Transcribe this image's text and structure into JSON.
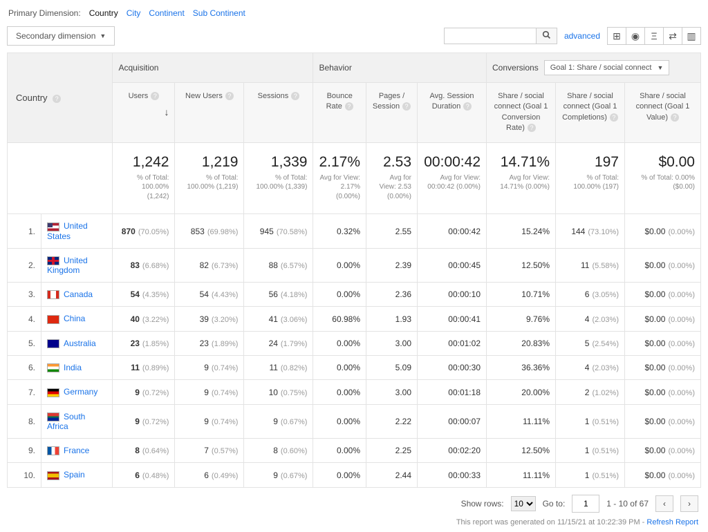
{
  "primaryDimension": {
    "label": "Primary Dimension:",
    "active": "Country",
    "links": [
      "City",
      "Continent",
      "Sub Continent"
    ]
  },
  "secondaryDimension": {
    "label": "Secondary dimension"
  },
  "advancedLink": "advanced",
  "table": {
    "countryHeader": "Country",
    "groups": {
      "acquisition": "Acquisition",
      "behavior": "Behavior",
      "conversions": "Conversions"
    },
    "goalSelector": "Goal 1: Share / social connect",
    "metrics": {
      "users": "Users",
      "newUsers": "New Users",
      "sessions": "Sessions",
      "bounce": "Bounce Rate",
      "pages": "Pages / Session",
      "avgDur": "Avg. Session Duration",
      "convRate": "Share / social connect (Goal 1 Conversion Rate)",
      "compl": "Share / social connect (Goal 1 Completions)",
      "value": "Share / social connect (Goal 1 Value)"
    },
    "totals": {
      "users": {
        "v": "1,242",
        "sub": "% of Total: 100.00% (1,242)"
      },
      "newUsers": {
        "v": "1,219",
        "sub": "% of Total: 100.00% (1,219)"
      },
      "sessions": {
        "v": "1,339",
        "sub": "% of Total: 100.00% (1,339)"
      },
      "bounce": {
        "v": "2.17%",
        "sub": "Avg for View: 2.17% (0.00%)"
      },
      "pages": {
        "v": "2.53",
        "sub": "Avg for View: 2.53 (0.00%)"
      },
      "avgDur": {
        "v": "00:00:42",
        "sub": "Avg for View: 00:00:42 (0.00%)"
      },
      "convRate": {
        "v": "14.71%",
        "sub": "Avg for View: 14.71% (0.00%)"
      },
      "compl": {
        "v": "197",
        "sub": "% of Total: 100.00% (197)"
      },
      "value": {
        "v": "$0.00",
        "sub": "% of Total: 0.00% ($0.00)"
      }
    },
    "rows": [
      {
        "n": "1.",
        "flag": "us",
        "country": "United States",
        "users": "870",
        "usersPct": "(70.05%)",
        "newUsers": "853",
        "newUsersPct": "(69.98%)",
        "sessions": "945",
        "sessionsPct": "(70.58%)",
        "bounce": "0.32%",
        "pages": "2.55",
        "dur": "00:00:42",
        "conv": "15.24%",
        "compl": "144",
        "complPct": "(73.10%)",
        "val": "$0.00",
        "valPct": "(0.00%)"
      },
      {
        "n": "2.",
        "flag": "gb",
        "country": "United Kingdom",
        "users": "83",
        "usersPct": "(6.68%)",
        "newUsers": "82",
        "newUsersPct": "(6.73%)",
        "sessions": "88",
        "sessionsPct": "(6.57%)",
        "bounce": "0.00%",
        "pages": "2.39",
        "dur": "00:00:45",
        "conv": "12.50%",
        "compl": "11",
        "complPct": "(5.58%)",
        "val": "$0.00",
        "valPct": "(0.00%)"
      },
      {
        "n": "3.",
        "flag": "ca",
        "country": "Canada",
        "users": "54",
        "usersPct": "(4.35%)",
        "newUsers": "54",
        "newUsersPct": "(4.43%)",
        "sessions": "56",
        "sessionsPct": "(4.18%)",
        "bounce": "0.00%",
        "pages": "2.36",
        "dur": "00:00:10",
        "conv": "10.71%",
        "compl": "6",
        "complPct": "(3.05%)",
        "val": "$0.00",
        "valPct": "(0.00%)"
      },
      {
        "n": "4.",
        "flag": "cn",
        "country": "China",
        "users": "40",
        "usersPct": "(3.22%)",
        "newUsers": "39",
        "newUsersPct": "(3.20%)",
        "sessions": "41",
        "sessionsPct": "(3.06%)",
        "bounce": "60.98%",
        "pages": "1.93",
        "dur": "00:00:41",
        "conv": "9.76%",
        "compl": "4",
        "complPct": "(2.03%)",
        "val": "$0.00",
        "valPct": "(0.00%)"
      },
      {
        "n": "5.",
        "flag": "au",
        "country": "Australia",
        "users": "23",
        "usersPct": "(1.85%)",
        "newUsers": "23",
        "newUsersPct": "(1.89%)",
        "sessions": "24",
        "sessionsPct": "(1.79%)",
        "bounce": "0.00%",
        "pages": "3.00",
        "dur": "00:01:02",
        "conv": "20.83%",
        "compl": "5",
        "complPct": "(2.54%)",
        "val": "$0.00",
        "valPct": "(0.00%)"
      },
      {
        "n": "6.",
        "flag": "in",
        "country": "India",
        "users": "11",
        "usersPct": "(0.89%)",
        "newUsers": "9",
        "newUsersPct": "(0.74%)",
        "sessions": "11",
        "sessionsPct": "(0.82%)",
        "bounce": "0.00%",
        "pages": "5.09",
        "dur": "00:00:30",
        "conv": "36.36%",
        "compl": "4",
        "complPct": "(2.03%)",
        "val": "$0.00",
        "valPct": "(0.00%)"
      },
      {
        "n": "7.",
        "flag": "de",
        "country": "Germany",
        "users": "9",
        "usersPct": "(0.72%)",
        "newUsers": "9",
        "newUsersPct": "(0.74%)",
        "sessions": "10",
        "sessionsPct": "(0.75%)",
        "bounce": "0.00%",
        "pages": "3.00",
        "dur": "00:01:18",
        "conv": "20.00%",
        "compl": "2",
        "complPct": "(1.02%)",
        "val": "$0.00",
        "valPct": "(0.00%)"
      },
      {
        "n": "8.",
        "flag": "za",
        "country": "South Africa",
        "users": "9",
        "usersPct": "(0.72%)",
        "newUsers": "9",
        "newUsersPct": "(0.74%)",
        "sessions": "9",
        "sessionsPct": "(0.67%)",
        "bounce": "0.00%",
        "pages": "2.22",
        "dur": "00:00:07",
        "conv": "11.11%",
        "compl": "1",
        "complPct": "(0.51%)",
        "val": "$0.00",
        "valPct": "(0.00%)"
      },
      {
        "n": "9.",
        "flag": "fr",
        "country": "France",
        "users": "8",
        "usersPct": "(0.64%)",
        "newUsers": "7",
        "newUsersPct": "(0.57%)",
        "sessions": "8",
        "sessionsPct": "(0.60%)",
        "bounce": "0.00%",
        "pages": "2.25",
        "dur": "00:02:20",
        "conv": "12.50%",
        "compl": "1",
        "complPct": "(0.51%)",
        "val": "$0.00",
        "valPct": "(0.00%)"
      },
      {
        "n": "10.",
        "flag": "es",
        "country": "Spain",
        "users": "6",
        "usersPct": "(0.48%)",
        "newUsers": "6",
        "newUsersPct": "(0.49%)",
        "sessions": "9",
        "sessionsPct": "(0.67%)",
        "bounce": "0.00%",
        "pages": "2.44",
        "dur": "00:00:33",
        "conv": "11.11%",
        "compl": "1",
        "complPct": "(0.51%)",
        "val": "$0.00",
        "valPct": "(0.00%)"
      }
    ]
  },
  "footer": {
    "showRows": "Show rows:",
    "rowsValue": "10",
    "goTo": "Go to:",
    "goToValue": "1",
    "range": "1 - 10 of 67",
    "generated": "This report was generated on 11/15/21 at 10:22:39 PM - ",
    "refresh": "Refresh Report"
  }
}
